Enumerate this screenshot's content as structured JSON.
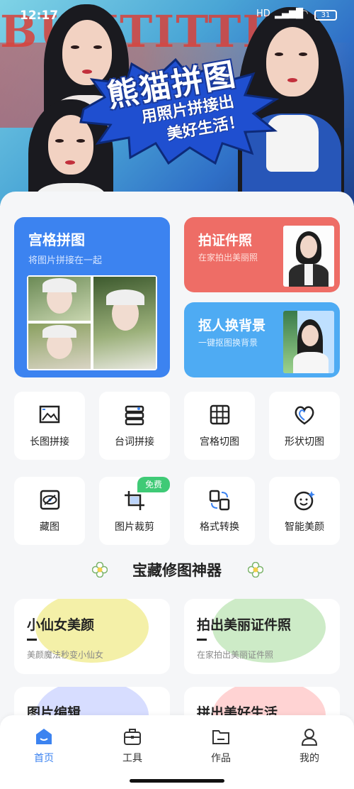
{
  "status": {
    "time": "12:17",
    "signal": "HD",
    "battery": "31"
  },
  "hero": {
    "bg_text": "BUNTITTHE",
    "title": "熊猫拼图",
    "subtitle_line1": "用照片拼接出",
    "subtitle_line2": "美好生活！"
  },
  "cards": {
    "grid": {
      "title": "宫格拼图",
      "subtitle": "将图片拼接在一起"
    },
    "photo": {
      "title": "拍证件照",
      "subtitle": "在家拍出美丽照"
    },
    "cutout": {
      "title": "抠人换背景",
      "subtitle": "一键抠图换背景"
    }
  },
  "tools": [
    {
      "label": "长图拼接",
      "icon": "image-stack-icon"
    },
    {
      "label": "台词拼接",
      "icon": "caption-stack-icon"
    },
    {
      "label": "宫格切图",
      "icon": "grid-icon"
    },
    {
      "label": "形状切图",
      "icon": "heart-icon"
    },
    {
      "label": "藏图",
      "icon": "eye-hide-icon"
    },
    {
      "label": "图片裁剪",
      "icon": "crop-icon"
    },
    {
      "label": "格式转换",
      "icon": "convert-icon"
    },
    {
      "label": "智能美颜",
      "icon": "smile-icon"
    }
  ],
  "free_badge": "免费",
  "section_title": "宝藏修图神器",
  "features": [
    {
      "title": "小仙女美颜",
      "subtitle": "美颜魔法秒变小仙女",
      "color": "#f4f0a8"
    },
    {
      "title": "拍出美丽证件照",
      "subtitle": "在家拍出美丽证件照",
      "color": "#cdebc7"
    },
    {
      "title": "图片编辑",
      "subtitle": "",
      "color": "#d7ddff"
    },
    {
      "title": "拼出美好生活",
      "subtitle": "",
      "color": "#ffd3d3"
    }
  ],
  "tabs": [
    {
      "label": "首页",
      "icon": "home-icon",
      "active": true
    },
    {
      "label": "工具",
      "icon": "toolbox-icon",
      "active": false
    },
    {
      "label": "作品",
      "icon": "folder-icon",
      "active": false
    },
    {
      "label": "我的",
      "icon": "profile-icon",
      "active": false
    }
  ],
  "colors": {
    "accent": "#3c83f0",
    "photo_card": "#ee6d66",
    "bg_card": "#4eabf3",
    "free": "#3fca76"
  }
}
